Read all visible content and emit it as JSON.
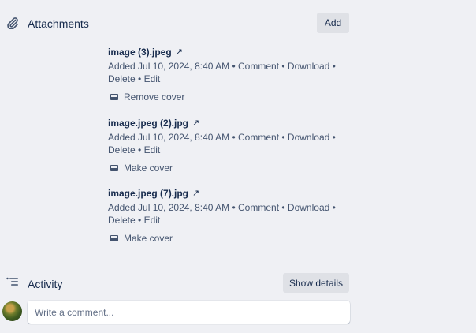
{
  "attachments": {
    "title": "Attachments",
    "icon": "paperclip-icon",
    "add_label": "Add",
    "items": [
      {
        "name": "image (3).jpeg",
        "link_glyph": "↗",
        "added": "Added Jul 10, 2024, 8:40 AM",
        "sep": "•",
        "comment": "Comment",
        "download": "Download",
        "delete": "Delete",
        "edit": "Edit",
        "cover_action": "Remove cover"
      },
      {
        "name": "image.jpeg (2).jpg",
        "link_glyph": "↗",
        "added": "Added Jul 10, 2024, 8:40 AM",
        "sep": "•",
        "comment": "Comment",
        "download": "Download",
        "delete": "Delete",
        "edit": "Edit",
        "cover_action": "Make cover"
      },
      {
        "name": "image.jpeg (7).jpg",
        "link_glyph": "↗",
        "added": "Added Jul 10, 2024, 8:40 AM",
        "sep": "•",
        "comment": "Comment",
        "download": "Download",
        "delete": "Delete",
        "edit": "Edit",
        "cover_action": "Make cover"
      }
    ]
  },
  "activity": {
    "title": "Activity",
    "icon": "activity-list-icon",
    "show_details_label": "Show details",
    "comment_placeholder": "Write a comment..."
  },
  "colors": {
    "background": "#eff0f4",
    "text_primary": "#172b4d",
    "text_secondary": "#44546f",
    "button_bg": "#dfe1e6"
  }
}
